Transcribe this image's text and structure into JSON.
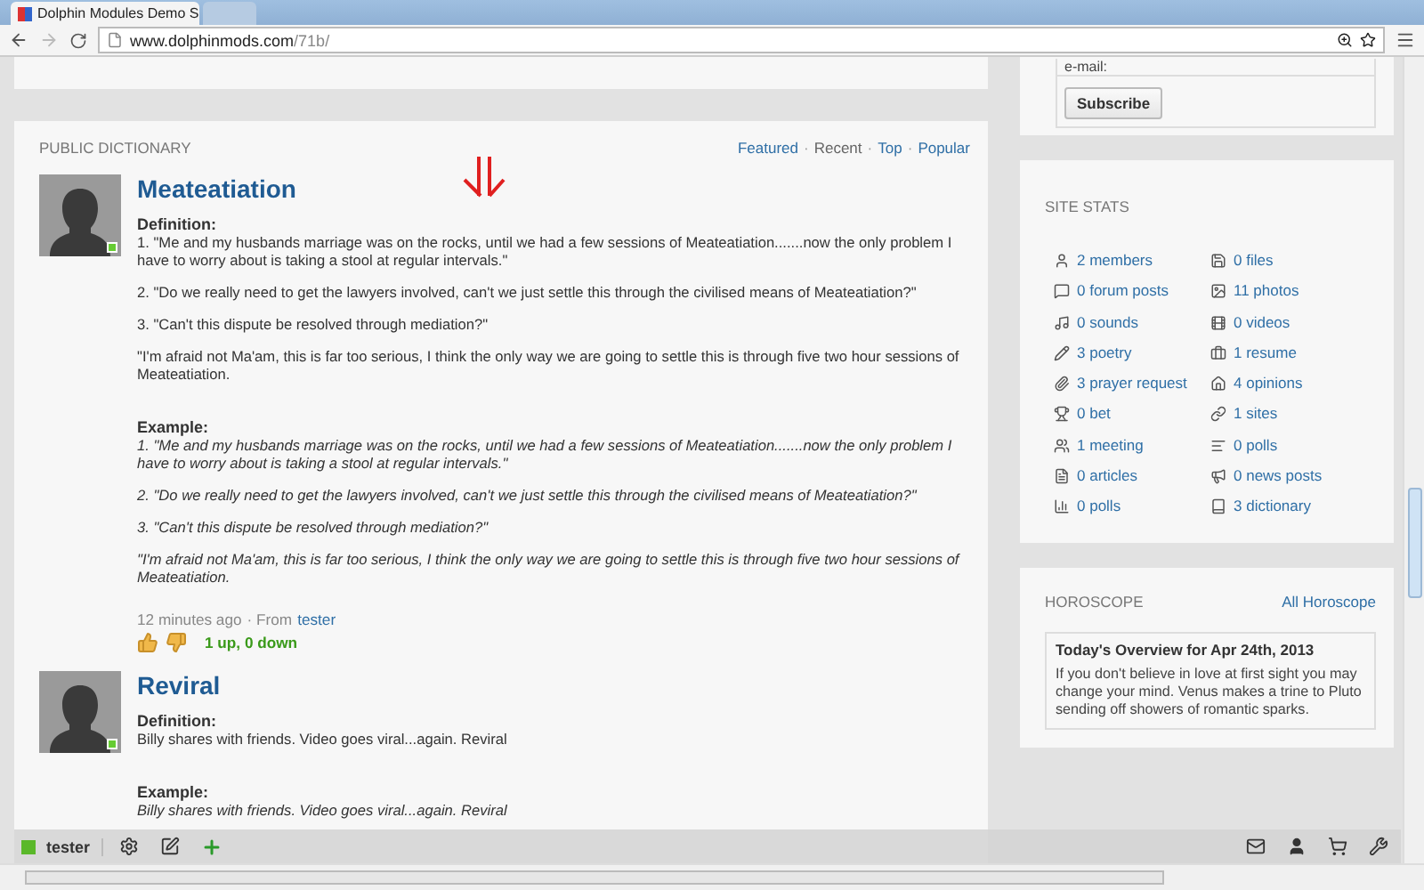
{
  "browser": {
    "tabs": [
      {
        "title": "Dolphin Modules Demo S",
        "selected": true
      },
      {
        "selected": false
      }
    ],
    "address": {
      "host": "www.dolphinmods.com",
      "path": "/71b/"
    }
  },
  "dictionary": {
    "heading": "PUBLIC DICTIONARY",
    "separator": "·",
    "filters": [
      {
        "label": "Featured",
        "selected": false
      },
      {
        "label": "Recent",
        "selected": true
      },
      {
        "label": "Top",
        "selected": false
      },
      {
        "label": "Popular",
        "selected": false
      }
    ],
    "entries": [
      {
        "title": "Meateatiation",
        "online": true,
        "definition_label": "Definition:",
        "definition": [
          "1. \"Me and my husbands marriage was on the rocks, until we had a few sessions of Meateatiation.......now the only problem I have to worry about is taking a stool at regular intervals.\"",
          "2. \"Do we really need to get the lawyers involved, can't we just settle this through the civilised means of Meateatiation?\"",
          "3. \"Can't this dispute be resolved through mediation?\"",
          "\"I'm afraid not Ma'am, this is far too serious, I think the only way we are going to settle this is through five two hour sessions of Meateatiation."
        ],
        "example_label": "Example:",
        "example": [
          "1. \"Me and my husbands marriage was on the rocks, until we had a few sessions of Meateatiation.......now the only problem I have to worry about is taking a stool at regular intervals.\"",
          "2. \"Do we really need to get the lawyers involved, can't we just settle this through the civilised means of Meateatiation?\"",
          "3. \"Can't this dispute be resolved through mediation?\"",
          "\"I'm afraid not Ma'am, this is far too serious, I think the only way we are going to settle this is through five two hour sessions of Meateatiation."
        ],
        "time": "12 minutes ago",
        "from": "· From",
        "author": "tester",
        "votes": "1 up, 0 down"
      },
      {
        "title": "Reviral",
        "online": true,
        "definition_label": "Definition:",
        "definition": [
          "Billy shares with friends. Video goes viral...again. Reviral"
        ],
        "example_label": "Example:",
        "example": [
          "Billy shares with friends. Video goes viral...again. Reviral"
        ]
      }
    ]
  },
  "subscribe": {
    "label": "e-mail:",
    "button": "Subscribe"
  },
  "site_stats": {
    "heading": "SITE STATS",
    "items": [
      "2 members",
      "0 files",
      "0 forum posts",
      "11 photos",
      "0 sounds",
      "0 videos",
      "3 poetry",
      "1 resume",
      "3 prayer request",
      "4 opinions",
      "0 bet",
      "1 sites",
      "1 meeting",
      "0 polls",
      "0 articles",
      "0 news posts",
      "0 polls",
      "3 dictionary"
    ]
  },
  "horoscope": {
    "heading": "HOROSCOPE",
    "link": "All Horoscope",
    "title": "Today's Overview for Apr 24th, 2013",
    "text": "If you don't believe in love at first sight you may change your mind. Venus makes a trine to Pluto sending off showers of romantic sparks."
  },
  "toolbar": {
    "user": "tester",
    "online": true
  }
}
